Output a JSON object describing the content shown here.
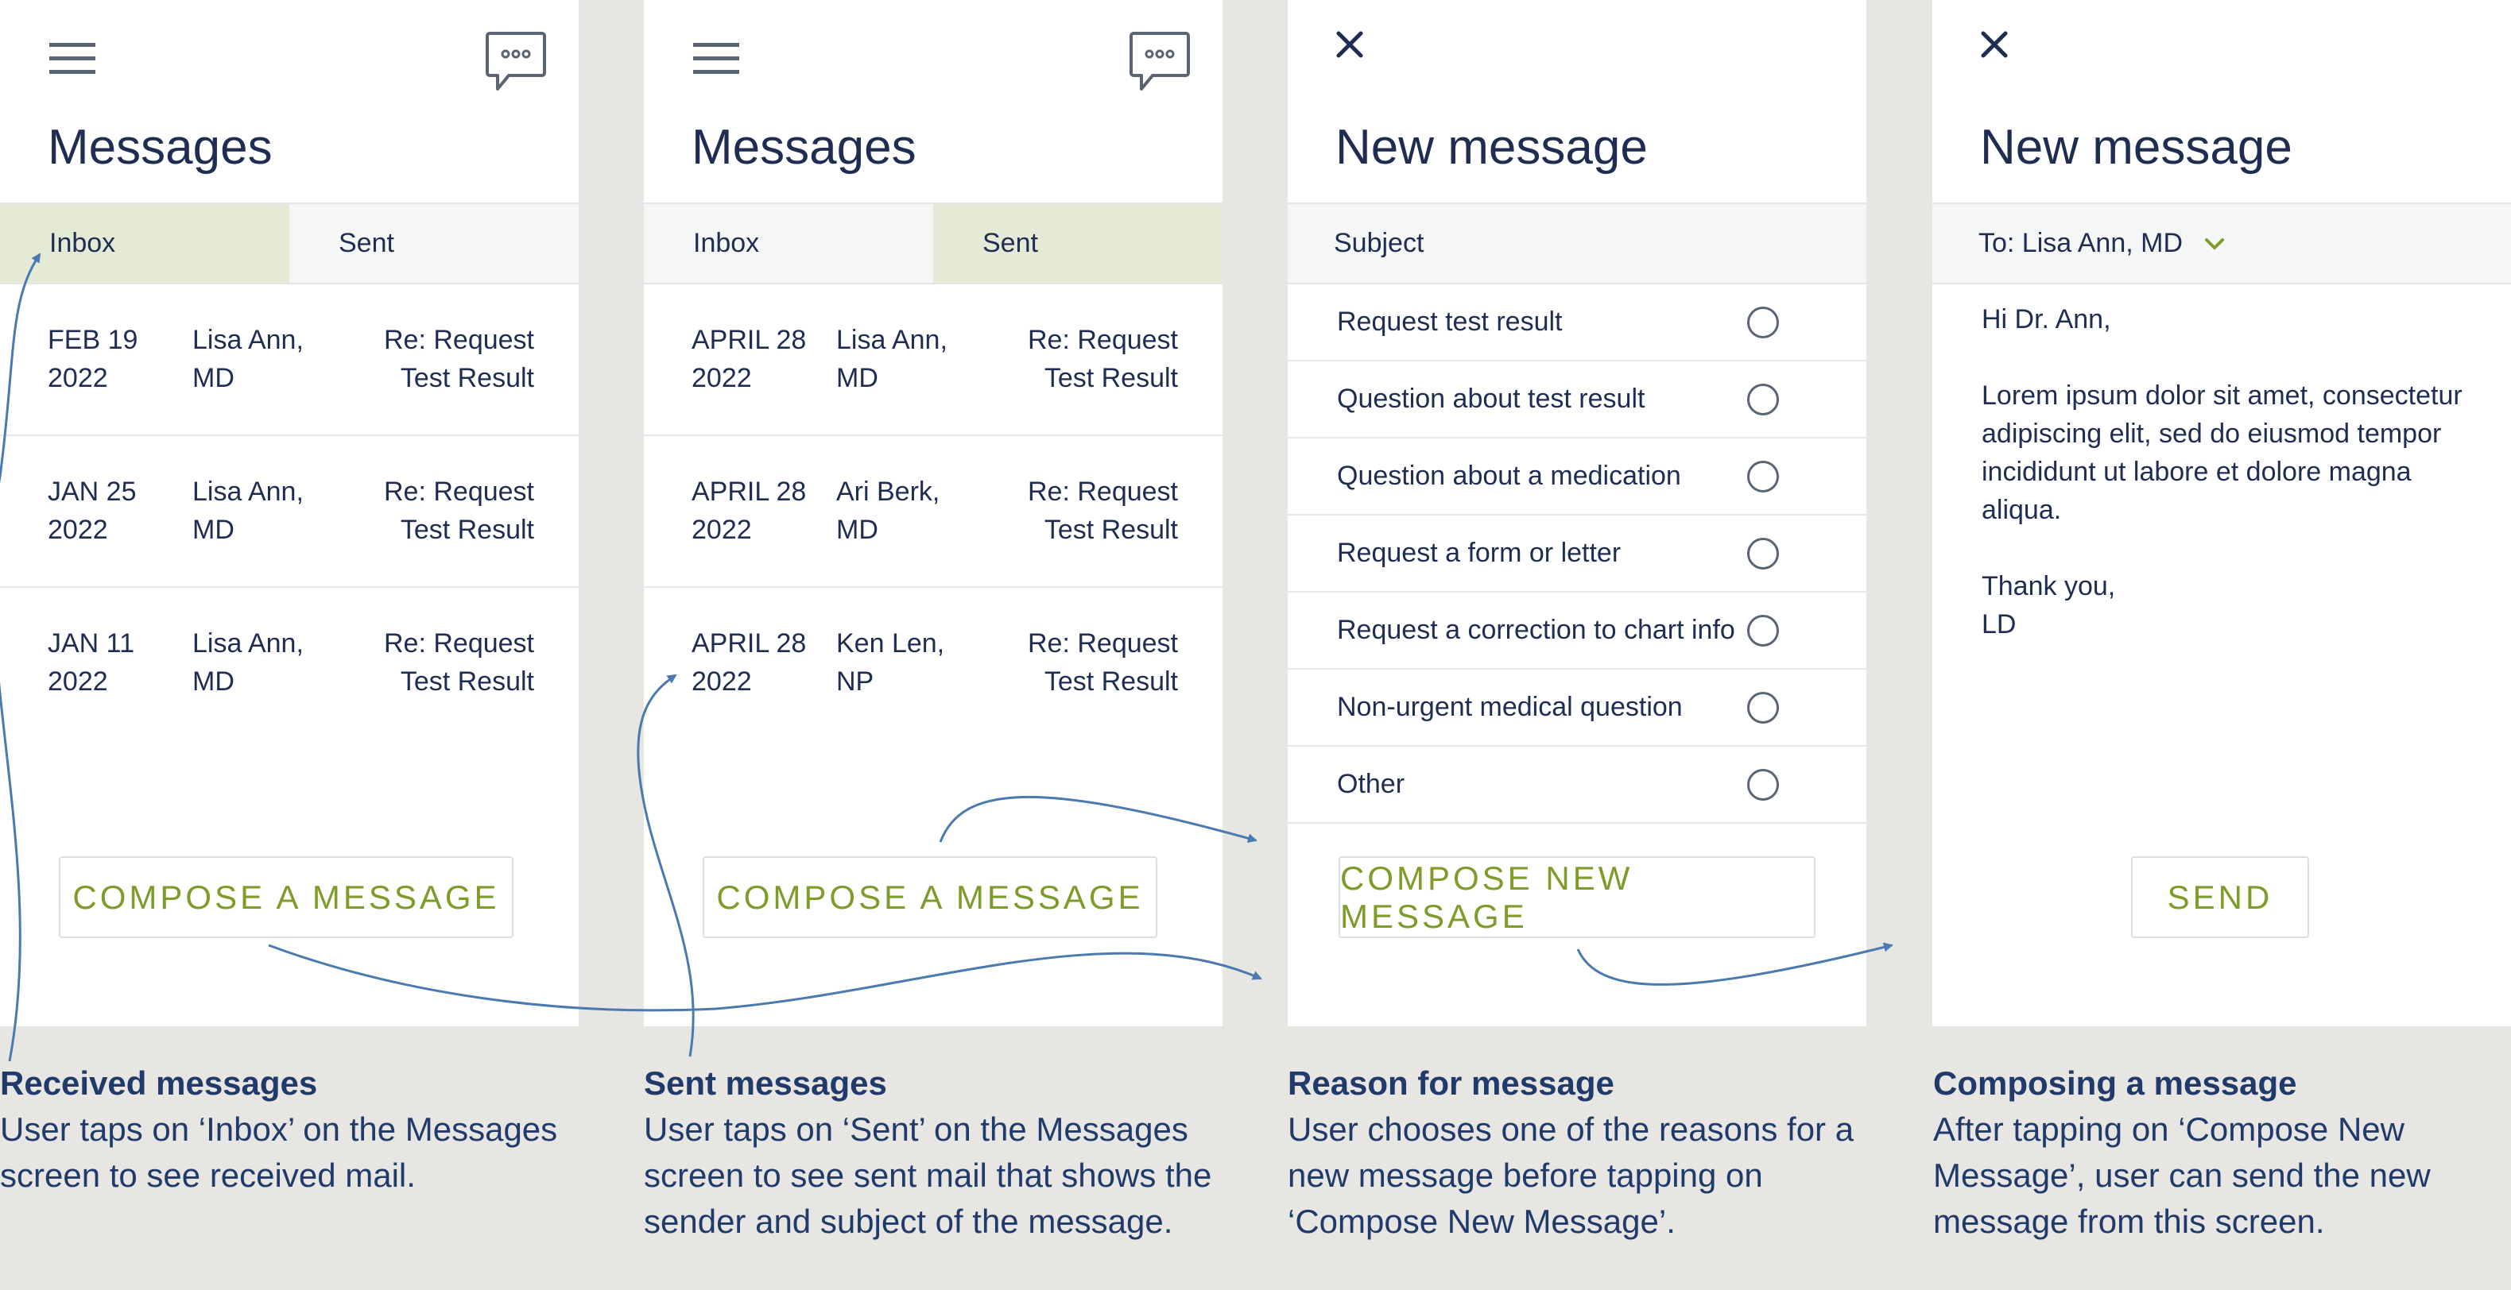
{
  "colors": {
    "background": "#e8e6e2",
    "screen": "#ffffff",
    "navy_text": "#1f2d52",
    "caption_text": "#1f3a6b",
    "green_accent": "#7f9c2a",
    "active_tab": "#e4ead6",
    "arrow": "#4a7ab0"
  },
  "screen1": {
    "title": "Messages",
    "tabs": [
      "Inbox",
      "Sent"
    ],
    "active_tab": "Inbox",
    "messages": [
      {
        "date": "FEB 19\n2022",
        "sender": "Lisa Ann,\nMD",
        "subject": "Re: Request\nTest Result"
      },
      {
        "date": "JAN 25\n2022",
        "sender": "Lisa Ann,\nMD",
        "subject": "Re: Request\nTest Result"
      },
      {
        "date": "JAN 11\n2022",
        "sender": "Lisa Ann,\nMD",
        "subject": "Re: Request\nTest Result"
      }
    ],
    "button": "COMPOSE A MESSAGE",
    "icons": [
      "hamburger-menu-icon",
      "chat-bubble-icon"
    ]
  },
  "screen2": {
    "title": "Messages",
    "tabs": [
      "Inbox",
      "Sent"
    ],
    "active_tab": "Sent",
    "messages": [
      {
        "date": "APRIL 28\n2022",
        "sender": "Lisa Ann,\nMD",
        "subject": "Re: Request\nTest Result"
      },
      {
        "date": "APRIL 28\n2022",
        "sender": "Ari Berk,\nMD",
        "subject": "Re: Request\nTest Result"
      },
      {
        "date": "APRIL 28\n2022",
        "sender": "Ken Len,\nNP",
        "subject": "Re: Request\nTest Result"
      }
    ],
    "button": "COMPOSE A MESSAGE",
    "icons": [
      "hamburger-menu-icon",
      "chat-bubble-icon"
    ]
  },
  "screen3": {
    "title": "New message",
    "subject_label": "Subject",
    "reasons": [
      "Request test result",
      "Question about test result",
      "Question about a medication",
      "Request a form or letter",
      "Request a correction to chart info",
      "Non-urgent medical question",
      "Other"
    ],
    "button": "COMPOSE NEW MESSAGE",
    "icons": [
      "close-icon",
      "radio-icon"
    ]
  },
  "screen4": {
    "title": "New message",
    "to_label": "To: Lisa Ann, MD",
    "body": "Hi Dr. Ann,\n\nLorem ipsum dolor sit amet, consectetur adipiscing elit, sed do eiusmod tempor incididunt ut labore et dolore magna aliqua.\n\nThank you,\nLD",
    "button": "SEND",
    "icons": [
      "close-icon",
      "chevron-down-icon"
    ]
  },
  "captions": [
    {
      "title": "Received messages",
      "text": "User taps on ‘Inbox’ on the Messages screen to see received mail."
    },
    {
      "title": "Sent messages",
      "text": "User taps on ‘Sent’ on the Messages screen to see sent mail that shows the sender and subject of the message."
    },
    {
      "title": "Reason for message",
      "text": "User chooses one of the reasons for a new message before tapping on ‘Compose New Message’."
    },
    {
      "title": "Composing a message",
      "text": "After tapping on ‘Compose New Message’, user can send the new message from this screen."
    }
  ]
}
